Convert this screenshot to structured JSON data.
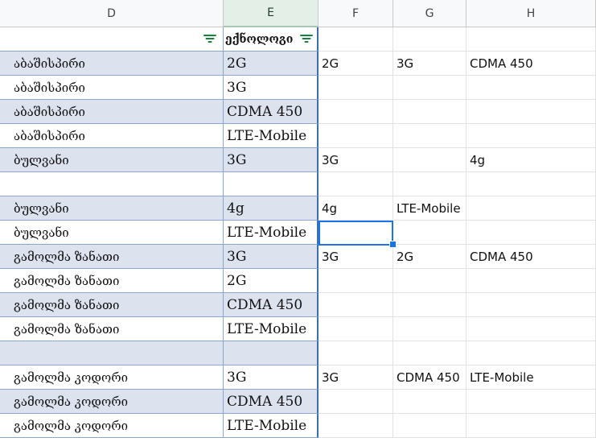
{
  "columns": [
    "D",
    "E",
    "F",
    "G",
    "H"
  ],
  "selected_column": "E",
  "header_row": {
    "d": "",
    "e": "ექნოლოგი"
  },
  "rows": [
    {
      "d": "აბაშისპირი",
      "e": "2G",
      "f": "2G",
      "g": "3G",
      "h": "CDMA 450",
      "band": true
    },
    {
      "d": "აბაშისპირი",
      "e": "3G",
      "f": "",
      "g": "",
      "h": "",
      "band": false
    },
    {
      "d": "აბაშისპირი",
      "e": "CDMA 450",
      "f": "",
      "g": "",
      "h": "",
      "band": true
    },
    {
      "d": "აბაშისპირი",
      "e": "LTE-Mobile",
      "f": "",
      "g": "",
      "h": "",
      "band": false
    },
    {
      "d": "ბულვანი",
      "e": "3G",
      "f": "3G",
      "g": "",
      "h": "4g",
      "band": true
    },
    {
      "d": "",
      "e": "",
      "f": "",
      "g": "",
      "h": "",
      "band": false
    },
    {
      "d": "ბულვანი",
      "e": "4g",
      "f": "4g",
      "g": "LTE-Mobile",
      "h": "",
      "band": true
    },
    {
      "d": "ბულვანი",
      "e": "LTE-Mobile",
      "f": "",
      "g": "",
      "h": "",
      "band": false
    },
    {
      "d": "გამოლმა ზანათი",
      "e": "3G",
      "f": "3G",
      "g": "2G",
      "h": "CDMA 450",
      "band": true
    },
    {
      "d": "გამოლმა ზანათი",
      "e": "2G",
      "f": "",
      "g": "",
      "h": "",
      "band": false
    },
    {
      "d": "გამოლმა ზანათი",
      "e": "CDMA 450",
      "f": "",
      "g": "",
      "h": "",
      "band": true
    },
    {
      "d": "გამოლმა ზანათი",
      "e": "LTE-Mobile",
      "f": "",
      "g": "",
      "h": "",
      "band": false
    },
    {
      "d": "",
      "e": "",
      "f": "",
      "g": "",
      "h": "",
      "band": true
    },
    {
      "d": "გამოლმა კოდორი",
      "e": "3G",
      "f": "3G",
      "g": "CDMA 450",
      "h": "LTE-Mobile",
      "band": false
    },
    {
      "d": "გამოლმა კოდორი",
      "e": "CDMA 450",
      "f": "",
      "g": "",
      "h": "",
      "band": true
    },
    {
      "d": "გამოლმა კოდორი",
      "e": "LTE-Mobile",
      "f": "",
      "g": "",
      "h": "",
      "band": false
    }
  ],
  "colors": {
    "band": "#dce3ee",
    "filter": "#188038",
    "selection": "#1a73e8"
  }
}
